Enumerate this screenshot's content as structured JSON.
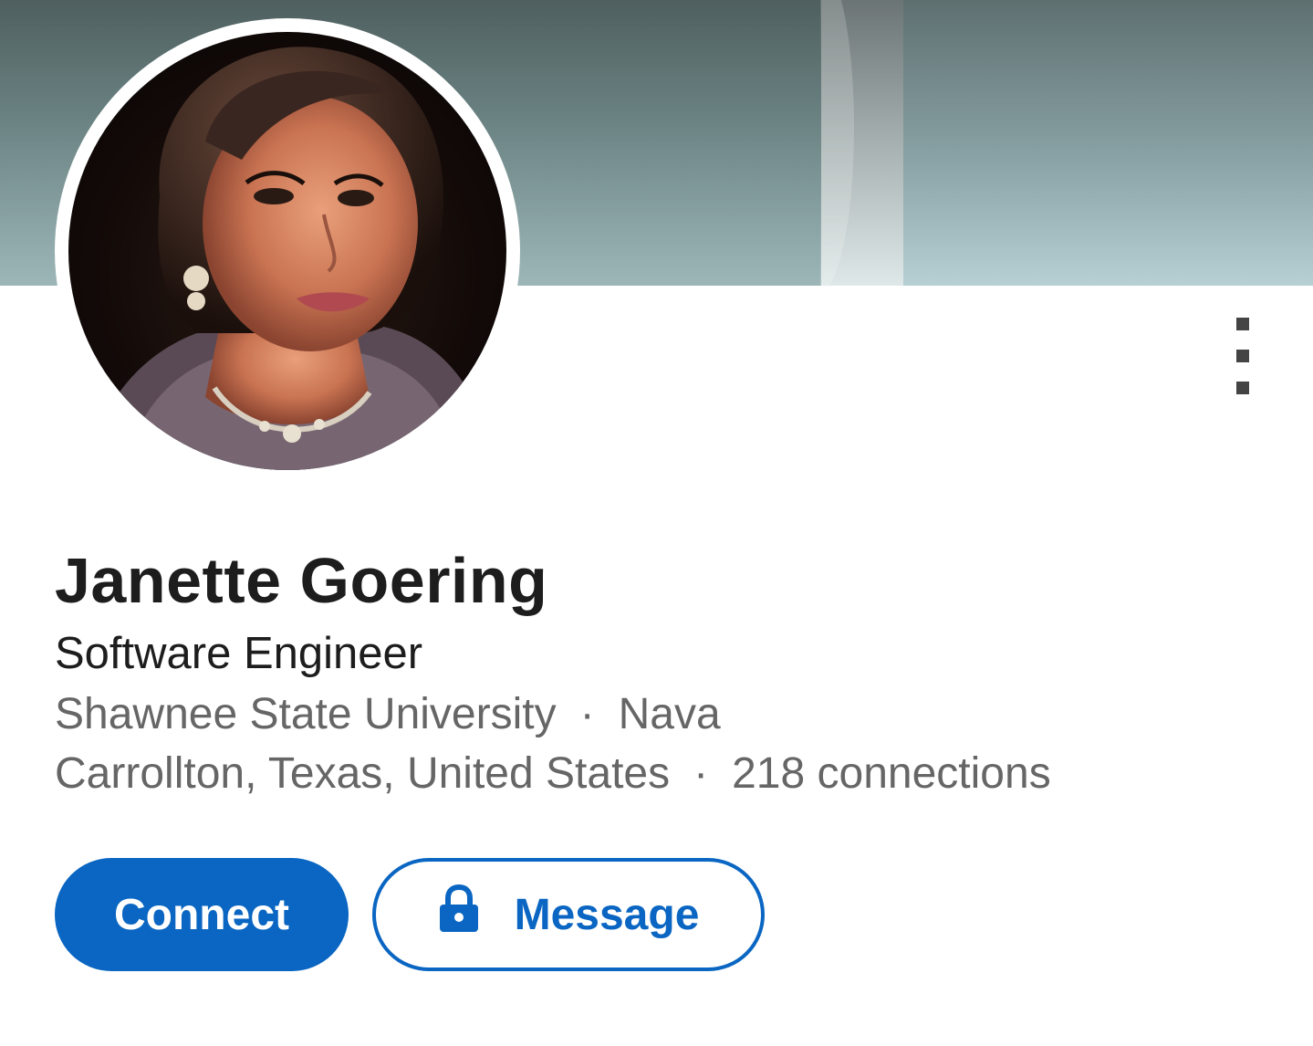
{
  "profile": {
    "name": "Janette Goering",
    "headline": "Software Engineer",
    "education": "Shawnee State University",
    "company": "Nava",
    "location": "Carrollton, Texas, United States",
    "connections": "218 connections",
    "separator": "·"
  },
  "actions": {
    "connect_label": "Connect",
    "message_label": "Message"
  },
  "icons": {
    "more": "more-vertical-icon",
    "lock": "lock-icon"
  },
  "colors": {
    "primary": "#0a66c2",
    "text_primary": "#1d1d1d",
    "text_secondary": "#666666"
  }
}
